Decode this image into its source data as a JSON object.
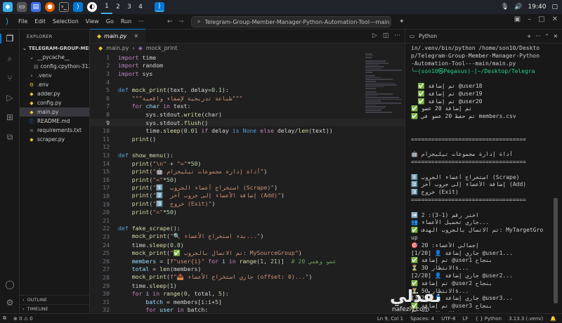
{
  "taskbar": {
    "workspaces": [
      "1",
      "2",
      "3",
      "4"
    ],
    "clock": "19:40"
  },
  "window": {
    "menu": [
      "File",
      "Edit",
      "Selection",
      "View",
      "Go",
      "Run",
      "···"
    ],
    "command_center": "Telegram-Group-Member-Manager-Python-Automation-Tool---main"
  },
  "explorer": {
    "header": "EXPLORER",
    "root": "TELEGRAM-GROUP-MEMB...",
    "items": [
      {
        "label": "__pycache__",
        "indent": 1,
        "icon": "folder-open-icon",
        "sel": false
      },
      {
        "label": "config.cpython-313....",
        "indent": 2,
        "icon": "file-icon",
        "sel": false
      },
      {
        "label": ".venv",
        "indent": 1,
        "icon": "folder-icon",
        "sel": false
      },
      {
        "label": ".env",
        "indent": 1,
        "icon": "gear-file-icon",
        "sel": false
      },
      {
        "label": "adder.py",
        "indent": 1,
        "icon": "python-icon",
        "sel": false
      },
      {
        "label": "config.py",
        "indent": 1,
        "icon": "python-icon",
        "sel": false
      },
      {
        "label": "main.py",
        "indent": 1,
        "icon": "python-icon",
        "sel": true
      },
      {
        "label": "README.md",
        "indent": 1,
        "icon": "info-icon",
        "sel": false
      },
      {
        "label": "requirements.txt",
        "indent": 1,
        "icon": "list-icon",
        "sel": false
      },
      {
        "label": "scraper.py",
        "indent": 1,
        "icon": "python-icon",
        "sel": false
      }
    ],
    "outline": "OUTLINE",
    "timeline": "TIMELINE"
  },
  "editor": {
    "tab": "main.py",
    "breadcrumb": [
      "main.py",
      "mock_print"
    ],
    "current_line": 9,
    "lines": [
      [
        [
          "import ",
          "kw"
        ],
        [
          "time",
          ""
        ]
      ],
      [
        [
          "import ",
          "kw"
        ],
        [
          "random",
          ""
        ]
      ],
      [
        [
          "import ",
          "kw"
        ],
        [
          "sys",
          ""
        ]
      ],
      [],
      [
        [
          "def ",
          "def"
        ],
        [
          "mock_print",
          "fn"
        ],
        [
          "(text, delay=",
          ""
        ],
        [
          "0.1",
          "num"
        ],
        [
          "):",
          ""
        ]
      ],
      [
        [
          "    ",
          ""
        ],
        [
          "\"\"\"طباعة تدريجية لإضفاء واقعية\"\"\"",
          "str"
        ]
      ],
      [
        [
          "    ",
          ""
        ],
        [
          "for ",
          "kw"
        ],
        [
          "char ",
          "var"
        ],
        [
          "in ",
          "kw"
        ],
        [
          "text:",
          ""
        ]
      ],
      [
        [
          "        sys.stdout.",
          ""
        ],
        [
          "write",
          "fn"
        ],
        [
          "(char)",
          ""
        ]
      ],
      [
        [
          "        sys.stdout.",
          ""
        ],
        [
          "flush",
          "fn"
        ],
        [
          "()",
          ""
        ]
      ],
      [
        [
          "        time.",
          ""
        ],
        [
          "sleep",
          "fn"
        ],
        [
          "(",
          ""
        ],
        [
          "0.01 ",
          "num"
        ],
        [
          "if ",
          "kw"
        ],
        [
          "delay ",
          ""
        ],
        [
          "is ",
          "def"
        ],
        [
          "None ",
          "bool"
        ],
        [
          "else ",
          "kw"
        ],
        [
          "delay/",
          ""
        ],
        [
          "len",
          "fn"
        ],
        [
          "(text))",
          ""
        ]
      ],
      [
        [
          "    ",
          ""
        ],
        [
          "print",
          "fn"
        ],
        [
          "()",
          ""
        ]
      ],
      [],
      [
        [
          "def ",
          "def"
        ],
        [
          "show_menu",
          "fn"
        ],
        [
          "():",
          ""
        ]
      ],
      [
        [
          "    ",
          ""
        ],
        [
          "print",
          "fn"
        ],
        [
          "(",
          ""
        ],
        [
          "\"\\n\" ",
          "str"
        ],
        [
          "+ ",
          ""
        ],
        [
          "\"=\"",
          "str"
        ],
        [
          "*",
          ""
        ],
        [
          "50",
          "num"
        ],
        [
          ")",
          ""
        ]
      ],
      [
        [
          "    ",
          ""
        ],
        [
          "print",
          "fn"
        ],
        [
          "(",
          ""
        ],
        [
          "\"🤖 أداة إدارة مجموعات تيليجرام\"",
          "str"
        ],
        [
          ")",
          ""
        ]
      ],
      [
        [
          "    ",
          ""
        ],
        [
          "print",
          "fn"
        ],
        [
          "(",
          ""
        ],
        [
          "\"=\"",
          "str"
        ],
        [
          "*",
          ""
        ],
        [
          "50",
          "num"
        ],
        [
          ")",
          ""
        ]
      ],
      [
        [
          "    ",
          ""
        ],
        [
          "print",
          "fn"
        ],
        [
          "(",
          ""
        ],
        [
          "\"1️⃣  استخراج أعضاء الجروب (Scrape)\"",
          "str"
        ],
        [
          ")",
          ""
        ]
      ],
      [
        [
          "    ",
          ""
        ],
        [
          "print",
          "fn"
        ],
        [
          "(",
          ""
        ],
        [
          "\"2️⃣  إضافة الأعضاء إلى جروب آخر (Add)\"",
          "str"
        ],
        [
          ")",
          ""
        ]
      ],
      [
        [
          "    ",
          ""
        ],
        [
          "print",
          "fn"
        ],
        [
          "(",
          ""
        ],
        [
          "\"3️⃣  خروج (Exit)\"",
          "str"
        ],
        [
          ")",
          ""
        ]
      ],
      [
        [
          "    ",
          ""
        ],
        [
          "print",
          "fn"
        ],
        [
          "(",
          ""
        ],
        [
          "\"=\"",
          "str"
        ],
        [
          "*",
          ""
        ],
        [
          "50",
          "num"
        ],
        [
          ")",
          ""
        ]
      ],
      [],
      [
        [
          "def ",
          "def"
        ],
        [
          "fake_scrape",
          "fn"
        ],
        [
          "():",
          ""
        ]
      ],
      [
        [
          "    ",
          ""
        ],
        [
          "mock_print",
          "fn"
        ],
        [
          "(",
          ""
        ],
        [
          "\"🔍 بدء استخراج الأعضاء...\"",
          "str"
        ],
        [
          ")",
          ""
        ]
      ],
      [
        [
          "    time.",
          ""
        ],
        [
          "sleep",
          "fn"
        ],
        [
          "(",
          ""
        ],
        [
          "0.8",
          "num"
        ],
        [
          ")",
          ""
        ]
      ],
      [
        [
          "    ",
          ""
        ],
        [
          "mock_print",
          "fn"
        ],
        [
          "(",
          ""
        ],
        [
          "\"✅ تم الاتصال بالجروب: MySourceGroup\"",
          "str"
        ],
        [
          ")",
          ""
        ]
      ],
      [
        [
          "    ",
          ""
        ],
        [
          "members ",
          "var"
        ],
        [
          "= [",
          ""
        ],
        [
          "f\"user{i}\" ",
          "str"
        ],
        [
          "for ",
          "kw"
        ],
        [
          "i ",
          "var"
        ],
        [
          "in ",
          "kw"
        ],
        [
          "range",
          "fn"
        ],
        [
          "(",
          ""
        ],
        [
          "1",
          "num"
        ],
        [
          ", ",
          ""
        ],
        [
          "21",
          "num"
        ],
        [
          ")]  ",
          ""
        ],
        [
          "# 20 عضو وهمي",
          "cm"
        ]
      ],
      [
        [
          "    ",
          ""
        ],
        [
          "total ",
          "var"
        ],
        [
          "= ",
          ""
        ],
        [
          "len",
          "fn"
        ],
        [
          "(members)",
          ""
        ]
      ],
      [
        [
          "    ",
          ""
        ],
        [
          "mock_print",
          "fn"
        ],
        [
          "(",
          ""
        ],
        [
          "f\"📥 جاري استخراج الأعضاء (offset: 0)...\"",
          "str"
        ],
        [
          ")",
          ""
        ]
      ],
      [
        [
          "    time.",
          ""
        ],
        [
          "sleep",
          "fn"
        ],
        [
          "(",
          ""
        ],
        [
          "1",
          "num"
        ],
        [
          ")",
          ""
        ]
      ],
      [
        [
          "    ",
          ""
        ],
        [
          "for ",
          "kw"
        ],
        [
          "i ",
          "var"
        ],
        [
          "in ",
          "kw"
        ],
        [
          "range",
          "fn"
        ],
        [
          "(",
          ""
        ],
        [
          "0",
          "num"
        ],
        [
          ", total, ",
          ""
        ],
        [
          "5",
          "num"
        ],
        [
          "):",
          ""
        ]
      ],
      [
        [
          "        ",
          ""
        ],
        [
          "batch ",
          "var"
        ],
        [
          "= members[i:i+",
          ""
        ],
        [
          "5",
          "num"
        ],
        [
          "]",
          ""
        ]
      ],
      [
        [
          "        ",
          ""
        ],
        [
          "for ",
          "kw"
        ],
        [
          "user ",
          "var"
        ],
        [
          "in ",
          "kw"
        ],
        [
          "batch:",
          ""
        ]
      ],
      [
        [
          "            ",
          ""
        ],
        [
          "mock_print",
          "fn"
        ],
        [
          "(f\"  ✅ ...  {user}\")",
          ""
        ]
      ]
    ]
  },
  "terminal": {
    "header": "Python",
    "lines": [
      "in/.venv/bin/python /home/son10/Deskto",
      "p/Telegram-Group-Member-Manager-Python",
      "-Automation-Tool---main/main.py",
      "╰─(son10㉿Pegasus)-[~/Desktop/Telegra",
      "",
      "  ✅ تم إضافة @user18",
      "  ✅ تم إضافة @user19",
      "  ✅ تم إضافة @user20",
      "✅ تم إضافة 20 عضو",
      "✅ تم حفظ 20 عضو في members.csv",
      "",
      "",
      "==================================",
      "",
      "🤖 أداة إدارة مجموعات تيليجرام",
      "==================================",
      "",
      "1️⃣ استخراج أعضاء الجروب (Scrape)",
      "2️⃣ إضافة الأعضاء إلى جروب آخر (Add)",
      "3️⃣ خروج (Exit)",
      "==================================",
      "",
      "➡️ اختر رقم (1-3): 2",
      "👥 جاري تحميل الأعضاء...",
      "✅ تم الاتصال بالجروب الهدف: MyTargetGro",
      "up",
      "🎯 إجمالي الأعضاء: 20",
      "[1/20] 👤 جاري إضافة @user1...",
      "✅ تم إضافة @user1 بنجاح",
      "⏳ الانتظار 30s...",
      "[2/20] 👤 جاري إضافة @user2...",
      "✅ تم إضافة @user2 بنجاح",
      "⏳ الانتظار 50s...",
      "[3/20] 👤 جاري إضافة @user3...",
      "✅ تم إضافة @user3 بنجاح",
      "⏳ الانتظار 67s...",
      "▌"
    ]
  },
  "statusbar": {
    "errors": "⊗ 0  ⚠ 0",
    "position": "Ln 9, Col 1",
    "spaces": "Spaces: 4",
    "encoding": "UTF-8",
    "eol": "LF",
    "language": "{ } Python",
    "interpreter": "3.13.3 (.venv)"
  },
  "watermark": {
    "text": "نفذلي",
    "url": "nafezly.com"
  }
}
